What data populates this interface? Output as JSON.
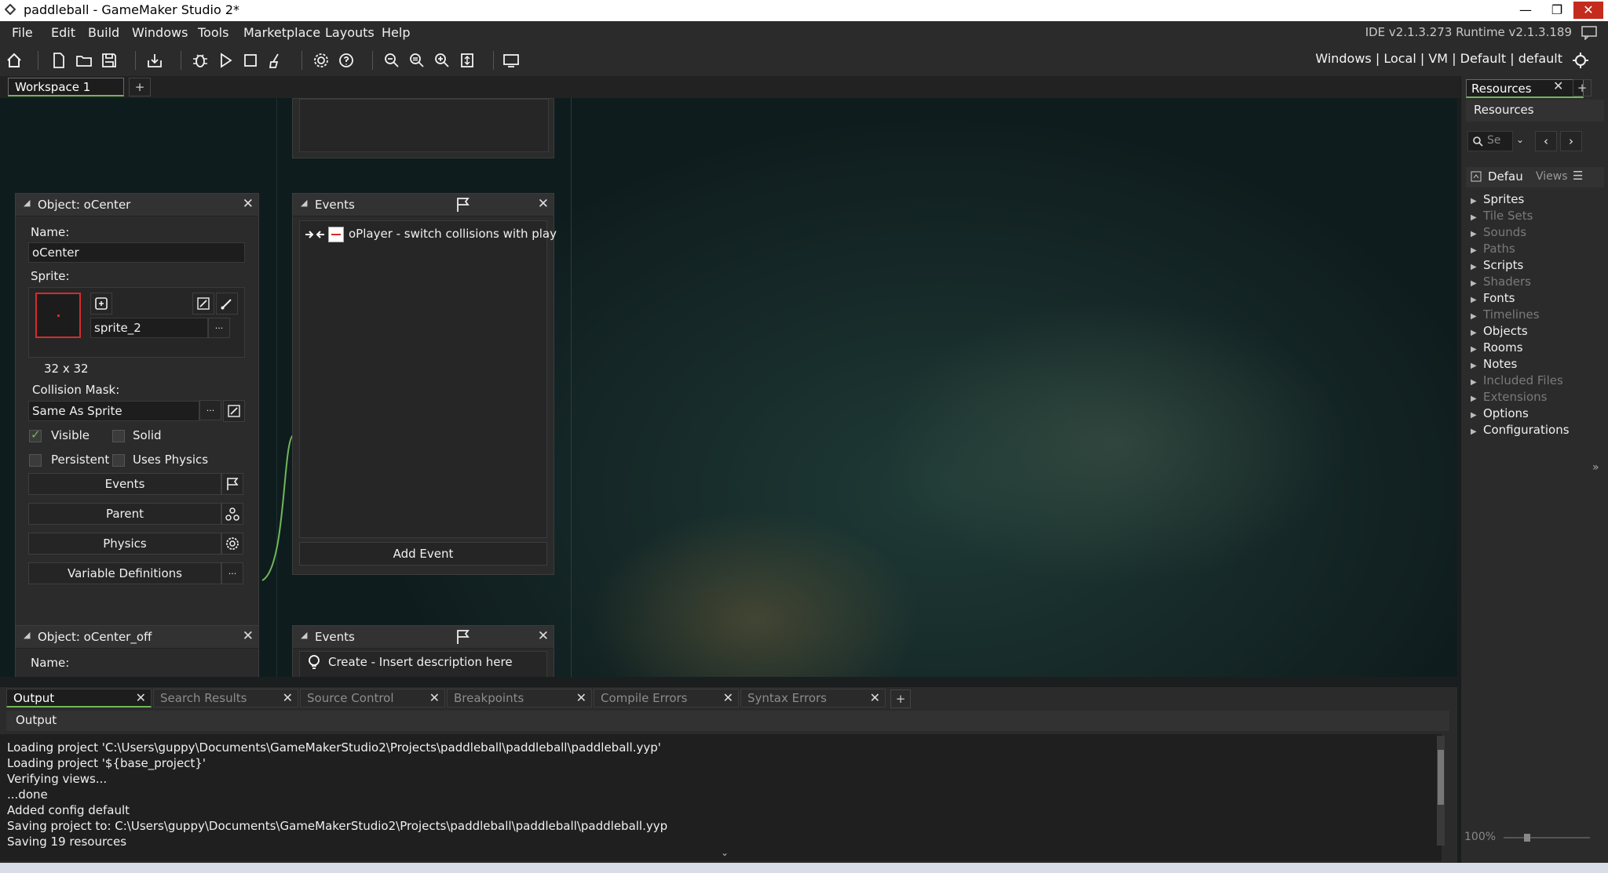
{
  "window": {
    "title": "paddleball - GameMaker Studio 2*",
    "minimize": "—",
    "restore": "❐",
    "close": "✕"
  },
  "menu": {
    "items": [
      "File",
      "Edit",
      "Build",
      "Windows",
      "Tools",
      "Marketplace",
      "Layouts",
      "Help"
    ],
    "ide_version": "IDE v2.1.3.273 Runtime v2.1.3.189"
  },
  "toolbar": {
    "target": "Windows | Local | VM | Default | default"
  },
  "workspace": {
    "tab": "Workspace 1",
    "add": "+"
  },
  "object_panel": {
    "title": "Object: oCenter",
    "name_label": "Name:",
    "name_value": "oCenter",
    "sprite_label": "Sprite:",
    "sprite_name": "sprite_2",
    "sprite_size": "32 x 32",
    "ellipsis": "···",
    "collision_label": "Collision Mask:",
    "collision_value": "Same As Sprite",
    "visible_label": "Visible",
    "visible": true,
    "solid_label": "Solid",
    "solid": false,
    "persistent_label": "Persistent",
    "persistent": false,
    "physics_check_label": "Uses Physics",
    "uses_physics": false,
    "events_button": "Events",
    "parent_button": "Parent",
    "physics_button": "Physics",
    "vardefs_button": "Variable Definitions"
  },
  "events_panel": {
    "title": "Events",
    "event_label": "oPlayer - switch collisions with play",
    "add_event": "Add Event"
  },
  "object_panel2": {
    "title": "Object: oCenter_off",
    "name_label": "Name:"
  },
  "events_panel2": {
    "title": "Events",
    "event_label": "Create - Insert description here"
  },
  "resources": {
    "tab": "Resources",
    "heading": "Resources",
    "search_placeholder": "Se",
    "filter": "Defau",
    "views": "Views",
    "items": [
      {
        "label": "Sprites",
        "dim": false
      },
      {
        "label": "Tile Sets",
        "dim": true
      },
      {
        "label": "Sounds",
        "dim": true
      },
      {
        "label": "Paths",
        "dim": true
      },
      {
        "label": "Scripts",
        "dim": false
      },
      {
        "label": "Shaders",
        "dim": true
      },
      {
        "label": "Fonts",
        "dim": false
      },
      {
        "label": "Timelines",
        "dim": true
      },
      {
        "label": "Objects",
        "dim": false
      },
      {
        "label": "Rooms",
        "dim": false
      },
      {
        "label": "Notes",
        "dim": false
      },
      {
        "label": "Included Files",
        "dim": true
      },
      {
        "label": "Extensions",
        "dim": true
      },
      {
        "label": "Options",
        "dim": false
      },
      {
        "label": "Configurations",
        "dim": false
      }
    ],
    "zoom": "100%"
  },
  "output": {
    "tabs": [
      "Output",
      "Search Results",
      "Source Control",
      "Breakpoints",
      "Compile Errors",
      "Syntax Errors"
    ],
    "heading": "Output",
    "lines": [
      "Loading project 'C:\\Users\\guppy\\Documents\\GameMakerStudio2\\Projects\\paddleball\\paddleball\\paddleball.yyp'",
      "Loading project '${base_project}'",
      "Verifying views...",
      "...done",
      "Added config default",
      "Saving project to: C:\\Users\\guppy\\Documents\\GameMakerStudio2\\Projects\\paddleball\\paddleball\\paddleball.yyp",
      "Saving 19 resources"
    ]
  }
}
